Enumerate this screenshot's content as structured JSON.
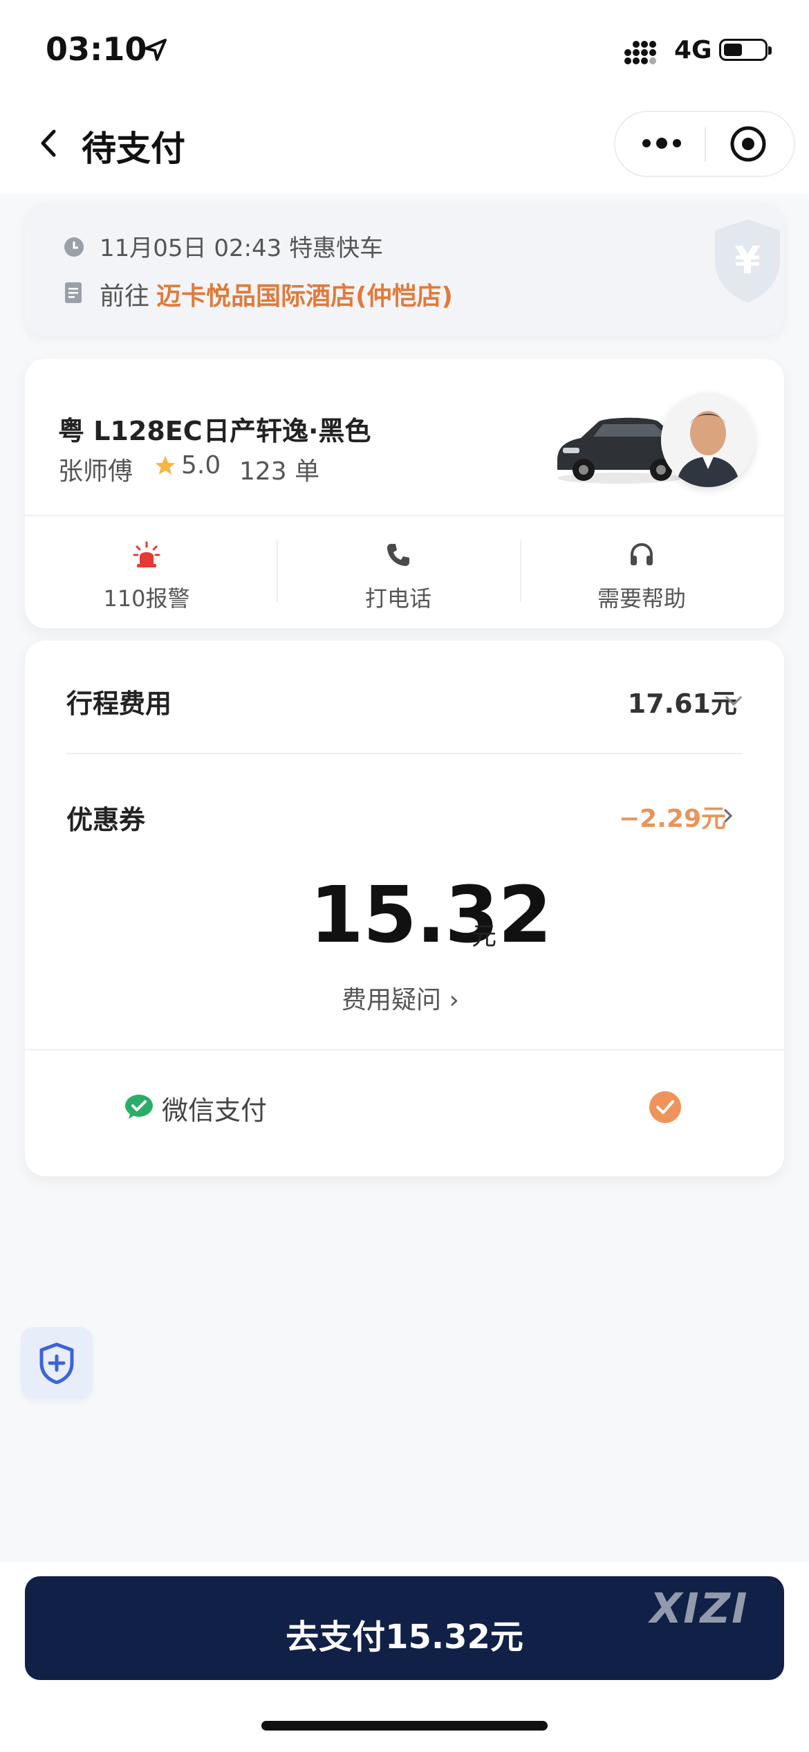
{
  "status_bar": {
    "time": "03:10",
    "network": "4G"
  },
  "nav": {
    "title": "待支付"
  },
  "trip": {
    "datetime_type": "11月05日 02:43 特惠快车",
    "goto_label": "前往",
    "destination": "迈卡悦品国际酒店(仲恺店)"
  },
  "driver": {
    "plate": "粤 L128EC",
    "car": "日产轩逸·黑色",
    "name": "张师傅",
    "rating": "5.0",
    "orders": "123 单",
    "actions": [
      {
        "label": "110报警",
        "icon": "alarm-icon"
      },
      {
        "label": "打电话",
        "icon": "phone-icon"
      },
      {
        "label": "需要帮助",
        "icon": "headset-icon"
      }
    ]
  },
  "fee": {
    "trip_fee_label": "行程费用",
    "trip_fee_value": "17.61元",
    "coupon_label": "优惠券",
    "coupon_value": "−2.29元",
    "total": "15.32",
    "unit": "元",
    "doubt_label": "费用疑问 ›",
    "pay_method": "微信支付"
  },
  "pay_button": {
    "label": "去支付15.32元"
  },
  "watermark": "XIZI",
  "colors": {
    "accent": "#e07a3a",
    "coupon": "#e9945a",
    "primary": "#102047",
    "wechat": "#2aae67"
  }
}
